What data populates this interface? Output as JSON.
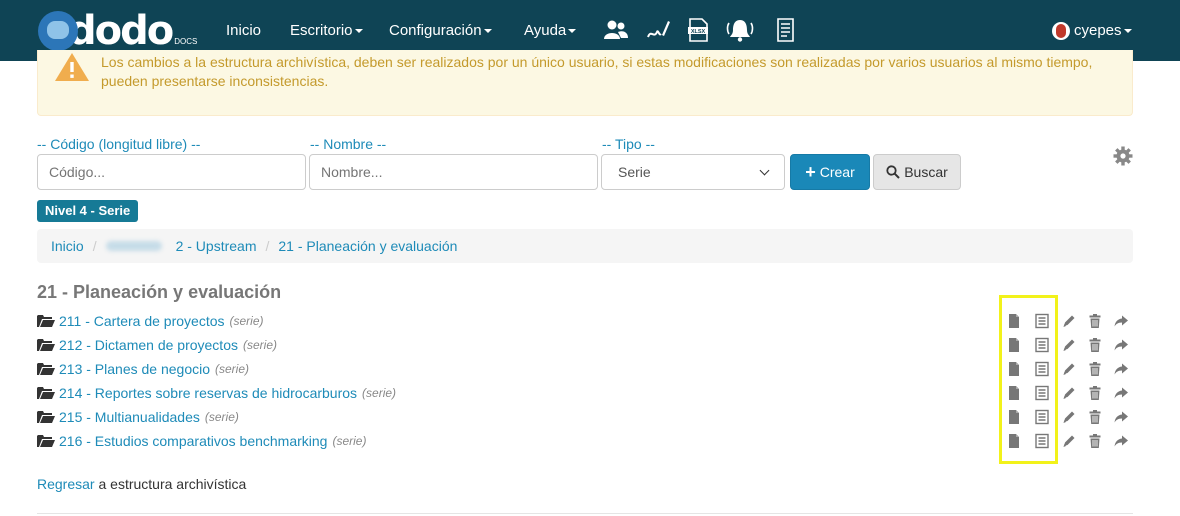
{
  "navbar": {
    "logo_text": "dodo",
    "logo_sub": "DOCS",
    "menu": [
      {
        "label": "Inicio",
        "has_caret": false
      },
      {
        "label": "Escritorio",
        "has_caret": true
      },
      {
        "label": "Configuración",
        "has_caret": true
      },
      {
        "label": "Ayuda",
        "has_caret": true
      }
    ],
    "icons": [
      "users-icon",
      "signature-icon",
      "xlsx-icon",
      "bell-icon",
      "document-list-icon"
    ],
    "user": "cyepes"
  },
  "alert": {
    "text": "Los cambios a la estructura archivística, deben ser realizados por un único usuario, si estas modificaciones son realizadas por varios usuarios al mismo tiempo, pueden presentarse inconsistencias."
  },
  "form": {
    "codigo_label": "-- Código (longitud libre) --",
    "codigo_placeholder": "Código...",
    "nombre_label": "-- Nombre --",
    "nombre_placeholder": "Nombre...",
    "tipo_label": "-- Tipo --",
    "tipo_value": "Serie",
    "crear_label": "Crear",
    "buscar_label": "Buscar"
  },
  "level_badge": "Nivel 4 - Serie",
  "breadcrumb": {
    "home": "Inicio",
    "items": [
      "2 - Upstream",
      "21 - Planeación y evaluación"
    ]
  },
  "heading": "21 - Planeación y evaluación",
  "rows": [
    {
      "label": "211 - Cartera de proyectos",
      "type": "(serie)"
    },
    {
      "label": "212 - Dictamen de proyectos",
      "type": "(serie)"
    },
    {
      "label": "213 - Planes de negocio",
      "type": "(serie)"
    },
    {
      "label": "214 - Reportes sobre reservas de hidrocarburos",
      "type": "(serie)"
    },
    {
      "label": "215 - Multianualidades",
      "type": "(serie)"
    },
    {
      "label": "216 - Estudios comparativos benchmarking",
      "type": "(serie)"
    }
  ],
  "row_actions": [
    "file-icon",
    "list-doc-icon",
    "pencil-icon",
    "trash-icon",
    "share-arrow-icon"
  ],
  "footer": {
    "link": "Regresar",
    "text": "a estructura archivística"
  },
  "colors": {
    "navbar": "#0f4455",
    "link": "#1e8bb8",
    "alert_bg": "#fcf8e3",
    "alert_text": "#c49a2c",
    "primary_button": "#1a88b8",
    "highlight": "#f2f21a"
  }
}
